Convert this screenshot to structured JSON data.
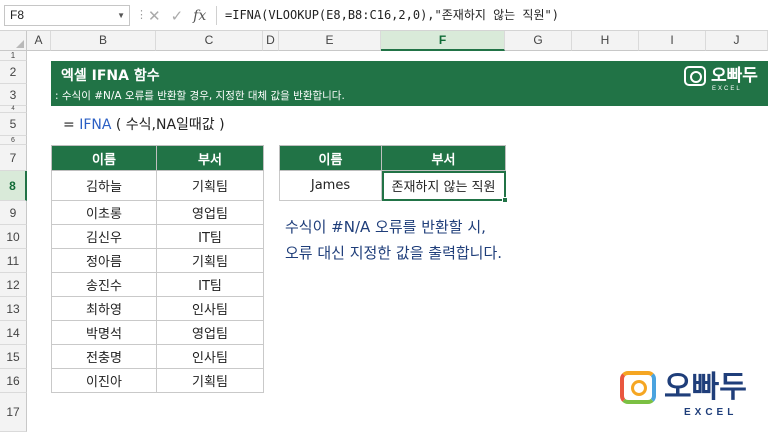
{
  "formula_bar": {
    "name_box": "F8",
    "formula": "=IFNA(VLOOKUP(E8,B8:C16,2,0),\"존재하지 않는 직원\")",
    "icons": [
      "cancel-icon",
      "enter-icon",
      "fx-icon"
    ],
    "fx_label": "fx"
  },
  "columns": [
    "A",
    "B",
    "C",
    "D",
    "E",
    "F",
    "G",
    "H",
    "I",
    "J"
  ],
  "selected_column": "F",
  "rows": [
    "1",
    "2",
    "3",
    "4",
    "5",
    "6",
    "7",
    "8",
    "9",
    "10",
    "11",
    "12",
    "13",
    "14",
    "15",
    "16",
    "17"
  ],
  "selected_row": "8",
  "banner": {
    "title": "엑셀 IFNA 함수",
    "subtitle": ": 수식이 #N/A 오류를 반환할 경우, 지정한 대체 값을 반환합니다.",
    "accent": "#217346"
  },
  "syntax": {
    "eq": "=",
    "fn": "IFNA",
    "args": "( 수식,NA일때값 )"
  },
  "table1": {
    "headers": [
      "이름",
      "부서"
    ],
    "rows": [
      [
        "김하늘",
        "기획팀"
      ],
      [
        "이초롱",
        "영업팀"
      ],
      [
        "김신우",
        "IT팀"
      ],
      [
        "정아름",
        "기획팀"
      ],
      [
        "송진수",
        "IT팀"
      ],
      [
        "최하영",
        "인사팀"
      ],
      [
        "박명석",
        "영업팀"
      ],
      [
        "전충명",
        "인사팀"
      ],
      [
        "이진아",
        "기획팀"
      ]
    ]
  },
  "table2": {
    "headers": [
      "이름",
      "부서"
    ],
    "row": [
      "James",
      "존재하지 않는 직원"
    ]
  },
  "description": {
    "line1": "수식이 #N/A 오류를 반환할 시,",
    "line2": "오류 대신 지정한 값을 출력합니다."
  },
  "logo": {
    "brand": "오빠두",
    "sub": "EXCEL"
  }
}
